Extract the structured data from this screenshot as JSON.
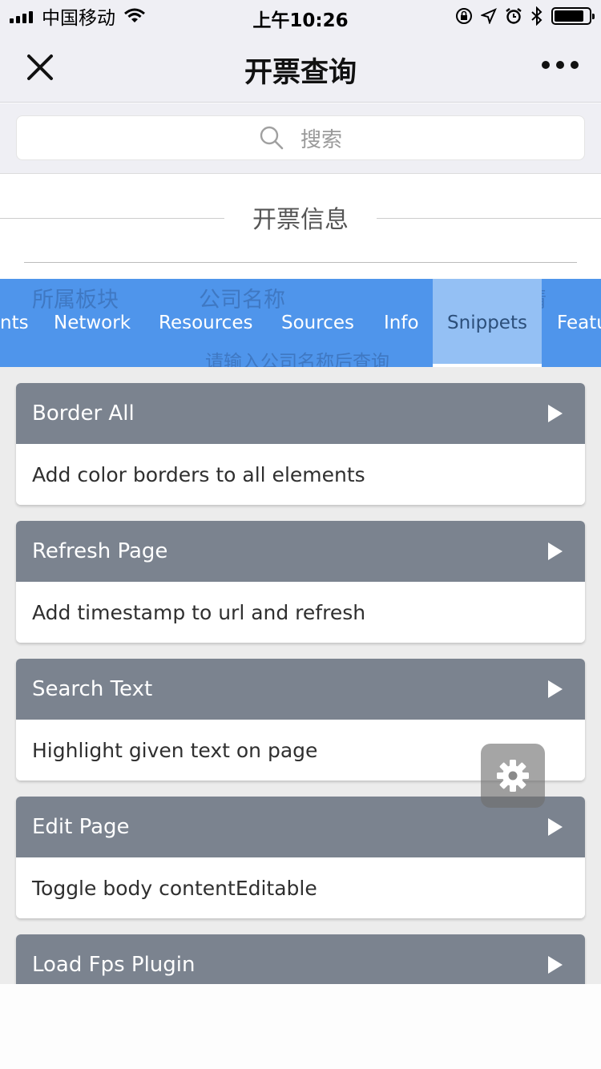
{
  "status_bar": {
    "carrier": "中国移动",
    "time": "上午10:26",
    "battery_level": 0.85
  },
  "nav": {
    "title": "开票查询"
  },
  "search": {
    "placeholder": "搜索"
  },
  "page": {
    "section_title": "开票信息",
    "ghost_texts": {
      "col1": "所属板块",
      "col2": "公司名称",
      "col3": "详情",
      "hint": "请输入公司名称后查询"
    }
  },
  "console": {
    "tabs": [
      {
        "label": "nts",
        "active": false
      },
      {
        "label": "Network",
        "active": false
      },
      {
        "label": "Resources",
        "active": false
      },
      {
        "label": "Sources",
        "active": false
      },
      {
        "label": "Info",
        "active": false
      },
      {
        "label": "Snippets",
        "active": true
      },
      {
        "label": "Featu",
        "active": false
      }
    ],
    "snippets": [
      {
        "name": "Border All",
        "desc": "Add color borders to all elements"
      },
      {
        "name": "Refresh Page",
        "desc": "Add timestamp to url and refresh"
      },
      {
        "name": "Search Text",
        "desc": "Highlight given text on page"
      },
      {
        "name": "Edit Page",
        "desc": "Toggle body contentEditable"
      },
      {
        "name": "Load Fps Plugin",
        "desc": ""
      }
    ]
  },
  "colors": {
    "tab_bar": "#4f95eb",
    "tab_active": "#94c0f4",
    "card_header": "#7b838f"
  }
}
